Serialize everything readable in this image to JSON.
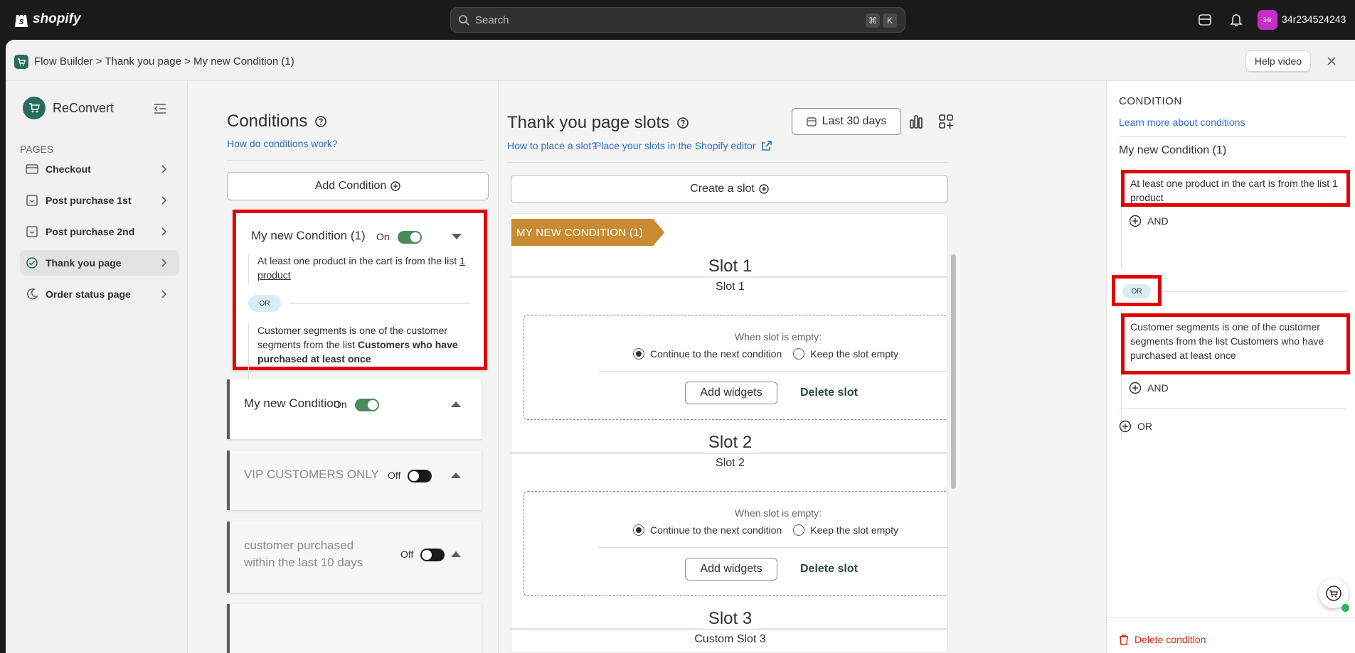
{
  "topbar": {
    "logo_text": "shopify",
    "search_placeholder": "Search",
    "kbd1": "⌘",
    "kbd2": "K",
    "avatar_initials": "34r",
    "store_name": "34r234524243"
  },
  "frame": {
    "breadcrumb": "Flow Builder > Thank you page > My new Condition (1)",
    "help_label": "Help video"
  },
  "sidebar": {
    "brand": "ReConvert",
    "section_label": "PAGES",
    "items": [
      {
        "label": "Checkout",
        "icon": "card-icon"
      },
      {
        "label": "Post purchase 1st",
        "icon": "page-icon"
      },
      {
        "label": "Post purchase 2nd",
        "icon": "page-icon"
      },
      {
        "label": "Thank you page",
        "icon": "check-badge-icon"
      },
      {
        "label": "Order status page",
        "icon": "moon-icon"
      }
    ]
  },
  "conditions": {
    "title": "Conditions",
    "link": "How do conditions work?",
    "add_label": "Add Condition",
    "cards": [
      {
        "title": "My new Condition (1)",
        "state": "On",
        "rule1_text": "At least one product in the cart is from the list ",
        "rule1_link": "1 product",
        "or_label": "OR",
        "rule2_text": "Customer segments is one of the customer segments from the list ",
        "rule2_bold": "Customers who have purchased at least once"
      },
      {
        "title": "My new Condition",
        "state": "On"
      },
      {
        "title": "VIP CUSTOMERS ONLY",
        "state": "Off"
      },
      {
        "title": "customer purchased within the last 10 days",
        "state": "Off"
      }
    ]
  },
  "slots": {
    "title": "Thank you page slots",
    "link1": "How to place a slot?",
    "link2": "Place your slots in the Shopify editor",
    "date_range": "Last 30 days",
    "create_label": "Create a slot",
    "ribbon": "MY NEW CONDITION (1)",
    "empty_label": "When slot is empty:",
    "option_continue": "Continue to the next condition",
    "option_keep": "Keep the slot empty",
    "add_widgets": "Add widgets",
    "delete_slot": "Delete slot",
    "items": [
      {
        "name": "Slot 1",
        "sub": "Slot 1"
      },
      {
        "name": "Slot 2",
        "sub": "Slot 2"
      },
      {
        "name": "Slot 3",
        "sub": "Custom Slot 3"
      }
    ]
  },
  "condition_panel": {
    "title": "CONDITION",
    "link": "Learn more about conditions",
    "name": "My new Condition (1)",
    "rule1": "At least one product in the cart is from the list 1 product",
    "and_label": "AND",
    "or_label": "OR",
    "rule2": "Customer segments is one of the customer segments from the list Customers who have purchased at least once",
    "add_or_label": "OR",
    "delete_label": "Delete condition"
  },
  "colors": {
    "accent_link": "#2c6ecb",
    "highlight": "#e30000",
    "ribbon": "#c98b32",
    "toggle_on": "#4a8b5c"
  }
}
